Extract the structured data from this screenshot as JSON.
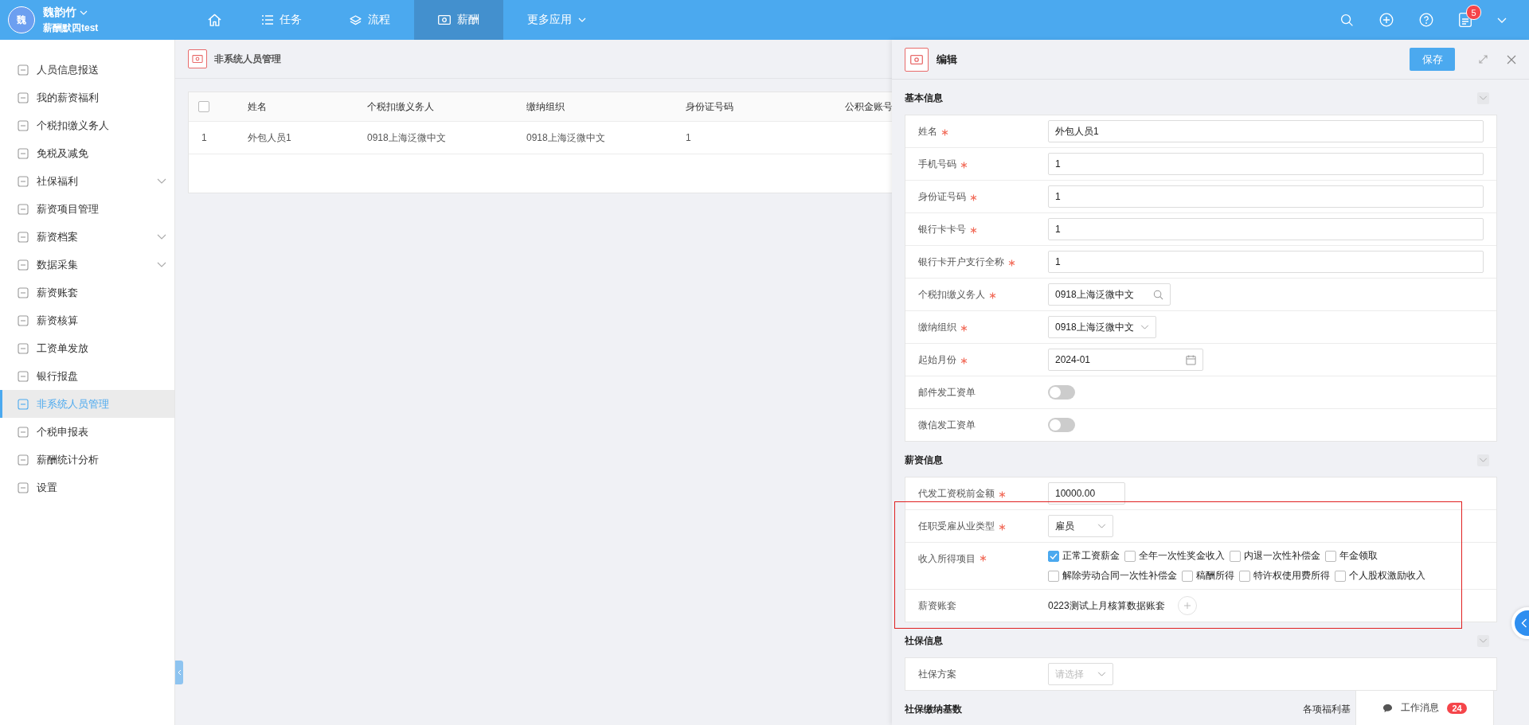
{
  "user": {
    "avatar": "魏",
    "name": "魏韵竹",
    "subtitle": "薪酬默四test"
  },
  "nav": [
    {
      "kind": "home",
      "selected": false
    },
    {
      "kind": "list",
      "label": "任务",
      "selected": false
    },
    {
      "kind": "layers",
      "label": "流程",
      "selected": false
    },
    {
      "kind": "money",
      "label": "薪酬",
      "selected": true
    },
    {
      "kind": "more",
      "label": "更多应用",
      "selected": false
    }
  ],
  "notification_count": "5",
  "sidebar": {
    "items": [
      {
        "label": "人员信息报送",
        "has_submenu": false,
        "selected": false
      },
      {
        "label": "我的薪资福利",
        "has_submenu": false,
        "selected": false
      },
      {
        "label": "个税扣缴义务人",
        "has_submenu": false,
        "selected": false
      },
      {
        "label": "免税及减免",
        "has_submenu": false,
        "selected": false
      },
      {
        "label": "社保福利",
        "has_submenu": true,
        "selected": false
      },
      {
        "label": "薪资项目管理",
        "has_submenu": false,
        "selected": false
      },
      {
        "label": "薪资档案",
        "has_submenu": true,
        "selected": false
      },
      {
        "label": "数据采集",
        "has_submenu": true,
        "selected": false
      },
      {
        "label": "薪资账套",
        "has_submenu": false,
        "selected": false
      },
      {
        "label": "薪资核算",
        "has_submenu": false,
        "selected": false
      },
      {
        "label": "工资单发放",
        "has_submenu": false,
        "selected": false
      },
      {
        "label": "银行报盘",
        "has_submenu": false,
        "selected": false
      },
      {
        "label": "非系统人员管理",
        "has_submenu": false,
        "selected": true
      },
      {
        "label": "个税申报表",
        "has_submenu": false,
        "selected": false
      },
      {
        "label": "薪酬统计分析",
        "has_submenu": false,
        "selected": false
      },
      {
        "label": "设置",
        "has_submenu": false,
        "selected": false
      }
    ]
  },
  "page": {
    "title": "非系统人员管理"
  },
  "table": {
    "select_all_checked": false,
    "columns": [
      "姓名",
      "个税扣缴义务人",
      "缴纳组织",
      "身份证号码",
      "公积金账号"
    ],
    "rows": [
      {
        "index": "1",
        "cells": [
          "外包人员1",
          "0918上海泛微中文",
          "0918上海泛微中文",
          "1"
        ]
      }
    ]
  },
  "editor": {
    "title": "编辑",
    "save": "保存",
    "sections": [
      {
        "title": "基本信息",
        "rows": [
          {
            "kind": "input",
            "label": "姓名",
            "required": true,
            "value": "外包人员1"
          },
          {
            "kind": "input",
            "label": "手机号码",
            "required": true,
            "value": "1"
          },
          {
            "kind": "input",
            "label": "身份证号码",
            "required": true,
            "value": "1"
          },
          {
            "kind": "input",
            "label": "银行卡卡号",
            "required": true,
            "value": "1"
          },
          {
            "kind": "input",
            "label": "银行卡开户支行全称",
            "required": true,
            "value": "1"
          },
          {
            "kind": "search",
            "label": "个税扣缴义务人",
            "required": true,
            "value": "0918上海泛微中文"
          },
          {
            "kind": "select",
            "label": "缴纳组织",
            "required": true,
            "value": "0918上海泛微中文"
          },
          {
            "kind": "date",
            "label": "起始月份",
            "required": true,
            "value": "2024-01"
          },
          {
            "kind": "toggle",
            "label": "邮件发工资单",
            "required": false,
            "on": false
          },
          {
            "kind": "toggle",
            "label": "微信发工资单",
            "required": false,
            "on": false
          }
        ]
      },
      {
        "title": "薪资信息",
        "rows": [
          {
            "kind": "number",
            "label": "代发工资税前金额",
            "required": true,
            "value": "10000.00"
          },
          {
            "kind": "select",
            "label": "任职受雇从业类型",
            "required": true,
            "value": "雇员"
          },
          {
            "kind": "checks",
            "label": "收入所得项目",
            "required": true,
            "options": [
              {
                "label": "正常工资薪金",
                "checked": true
              },
              {
                "label": "全年一次性奖金收入",
                "checked": false
              },
              {
                "label": "内退一次性补偿金",
                "checked": false
              },
              {
                "label": "年金领取",
                "checked": false
              },
              {
                "label": "解除劳动合同一次性补偿金",
                "checked": false
              },
              {
                "label": "稿酬所得",
                "checked": false
              },
              {
                "label": "特许权使用费所得",
                "checked": false
              },
              {
                "label": "个人股权激励收入",
                "checked": false
              }
            ]
          },
          {
            "kind": "text",
            "label": "薪资账套",
            "required": false,
            "value": "0223测试上月核算数据账套"
          }
        ]
      },
      {
        "title": "社保信息",
        "rows": [
          {
            "kind": "select",
            "label": "社保方案",
            "required": false,
            "placeholder": "请选择"
          }
        ]
      },
      {
        "title": "社保缴纳基数",
        "aside": "各项福利基"
      }
    ]
  },
  "work_message": {
    "label": "工作消息",
    "count": "24"
  }
}
